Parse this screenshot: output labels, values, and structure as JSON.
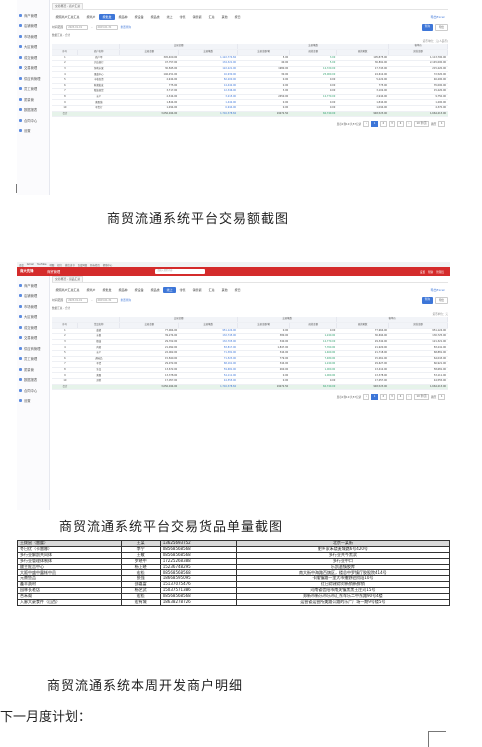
{
  "sidebar": {
    "items": [
      "商户管理",
      "店铺管理",
      "市场管理",
      "大区管理",
      "成交管理",
      "交易管理",
      "供应商管理",
      "员工管理",
      "质量管",
      "数据报表",
      "合同中心",
      "设置"
    ]
  },
  "browser": {
    "bookmarks": [
      "百度",
      "Gmail",
      "YouTube",
      "地图",
      "招行",
      "微信读书",
      "百度网盘",
      "新标签页",
      "帮助中心"
    ],
    "logo": "商大先锋",
    "title": "商贸管理",
    "search_placeholder": "请输入搜索内容",
    "right_items": [
      "设置",
      "帮助",
      "管理员"
    ]
  },
  "shot1": {
    "path_tab": "交易概况 - 商户汇总",
    "tabs": [
      "按照商户汇总汇总",
      "按商户",
      "按批发",
      "按品种",
      "按设备",
      "按品类",
      "线上",
      "零售",
      "销售额",
      "汇总",
      "其他",
      "按日"
    ],
    "active_tab": 2,
    "download": "导出Excel",
    "filter_label": "时间范围",
    "date_from": "2023-01-01",
    "date_to": "2023-01-31",
    "link": "重置查询",
    "query": "查询",
    "export": "导出",
    "summary": "数据汇总 - 合计",
    "unit": "货币单位：元(人民币)",
    "group_headers": [
      "交易金额",
      "交易笔数",
      "客单价"
    ],
    "columns": [
      "序号",
      "商户名称",
      "交易金额",
      "交易笔数",
      "交易金额/笔",
      "客单价(元)",
      "退款金额",
      "退款笔数",
      "实收金额"
    ],
    "rows": [
      [
        "1",
        "商户甲",
        "345,400.00",
        "1,122,774.84",
        "5.00",
        "3.00",
        "105,875.00",
        "1,113,700.00"
      ],
      [
        "2",
        "兴达商行",
        "47,757.00",
        "134,321.00",
        "40.00",
        "5.00",
        "36,891.00",
        "2,145,000.00"
      ],
      [
        "3",
        "恒利水果",
        "30,845.00",
        "122,221.00",
        "1980.00",
        "12,720.00",
        "17,743.00",
        "215,220.00"
      ],
      [
        "4",
        "果蔬中心",
        "146,251.00",
        "16,930.00",
        "30.00",
        "25,000.00",
        "24,612.00",
        "72,520.00"
      ],
      [
        "5",
        "丰收农资",
        "2,944.00",
        "82,200.00",
        "0.00",
        "0.00",
        "5,222.00",
        "46,200.00"
      ],
      [
        "6",
        "鲜菜批发",
        "775.00",
        "14,442.00",
        "0.00",
        "0.00",
        "775.00",
        "35,000.00"
      ],
      [
        "7",
        "粮油商贸",
        "3,717.00",
        "12,346.00",
        "3.00",
        "0.00",
        "3,102.00",
        "15,220.00"
      ],
      [
        "8",
        "水产",
        "2,344.00",
        "3,215.00",
        "2450.00",
        "12,770.00",
        "2,944.00",
        "9,750.00"
      ],
      [
        "9",
        "禽蛋铺",
        "1,844.00",
        "1,442.00",
        "0.00",
        "0.00",
        "1,844.00",
        "1,200.00"
      ],
      [
        "10",
        "干货行",
        "1,094.00",
        "6,944.00",
        "0.00",
        "0.00",
        "1,094.00",
        "4,370.00"
      ],
      [
        "合计",
        "",
        "3,056,944.00",
        "1,716,378.84",
        "19272.50",
        "60,740.00",
        "948,523.00",
        "1,664,213.00"
      ]
    ],
    "pager": {
      "total": "显示1到10 共57记录",
      "pages": [
        "1",
        "2",
        "3",
        "4"
      ],
      "active": "1",
      "per_page": "10 条/页",
      "goto": "跳至"
    }
  },
  "shot2": {
    "path_tab": "交易概况 - 货品汇总",
    "tabs": [
      "按照商户汇总汇总",
      "按商户",
      "按批发",
      "按品种",
      "按设备",
      "按品类",
      "线上",
      "零售",
      "销售额",
      "汇总",
      "其他",
      "按日"
    ],
    "active_tab": 6,
    "download": "导出Excel",
    "filter_label": "时间范围",
    "date_from": "2023-01-01",
    "date_to": "2023-01-31",
    "link": "重置查询",
    "query": "查询",
    "export": "导出",
    "summary": "数据汇总 - 合计",
    "unit": "货币单位：元",
    "group_headers": [
      "交易金额",
      "交易笔数",
      "客单价"
    ],
    "columns": [
      "序号",
      "货品名称",
      "交易金额",
      "交易笔数",
      "交易金额/笔",
      "退款金额",
      "退款笔数",
      "实收金额"
    ],
    "rows": [
      [
        "1",
        "蔬菜",
        "77,964.00",
        "951,124.00",
        "0.00",
        "0.00",
        "77,964.00",
        "951,124.00"
      ],
      [
        "2",
        "水果",
        "39,274.00",
        "132,745.00",
        "380.00",
        "1,240.00",
        "36,694.00",
        "130,725.00"
      ],
      [
        "3",
        "粮油",
        "29,702.00",
        "132,705.00",
        "340.00",
        "12,770.00",
        "29,342.00",
        "121,321.00"
      ],
      [
        "4",
        "肉禽",
        "21,992.00",
        "83,817.00",
        "1,847.00",
        "7,760.00",
        "21,920.00",
        "83,241.00"
      ],
      [
        "5",
        "水产",
        "22,062.00",
        "71,381.00",
        "344.00",
        "1,460.00",
        "21,718.00",
        "68,881.00"
      ],
      [
        "6",
        "调味品",
        "15,840.00",
        "71,523.00",
        "779.00",
        "7,480.00",
        "15,061.00",
        "64,043.00"
      ],
      [
        "7",
        "干货",
        "29,972.00",
        "68,161.00",
        "344.00",
        "1,240.00",
        "29,627.00",
        "66,921.00"
      ],
      [
        "8",
        "冻品",
        "13,672.00",
        "59,681.00",
        "260.00",
        "1,000.00",
        "13,412.00",
        "58,681.00"
      ],
      [
        "9",
        "禽蛋",
        "13,378.00",
        "54,111.00",
        "0.00",
        "1,000.00",
        "13,378.00",
        "53,111.00"
      ],
      [
        "10",
        "其他",
        "17,057.00",
        "44,555.00",
        "0.00",
        "0.00",
        "17,057.00",
        "44,555.00"
      ],
      [
        "合计",
        "",
        "3,056,944.00",
        "1,716,378.84",
        "19272.50",
        "60,740.00",
        "948,523.00",
        "1,664,213.00"
      ]
    ],
    "pager": {
      "total": "显示1到10 共57记录",
      "pages": [
        "1",
        "2",
        "3",
        "4"
      ],
      "active": "1",
      "per_page": "10 条/页",
      "goto": "跳至"
    }
  },
  "captions": {
    "cap1": "商贸流通系统平台交易额截图",
    "cap2": "商贸流通系统平台交易货品单量截图",
    "cap3": "商贸流通系统本周开发商户明细",
    "note": "下一月度计划："
  },
  "merchants": {
    "header": [
      "土拨鼠（雷霆）",
      "王某",
      "13625693752",
      "北京一某街"
    ],
    "rows": [
      [
        "冬日优（卡雷娜）",
        "李宁",
        "08568568568",
        "肥乡家禾烧麦城路6号420号"
      ],
      [
        "多行业解剖共同体",
        "王敏",
        "08568568568",
        "多行业共今黑滨"
      ],
      [
        "多行业管理体制体",
        "罗晓中",
        "17225268388",
        "多行业中口"
      ],
      [
        "酸主批吉中心",
        "杨上晓",
        "15236748295",
        "乐凯滋镇胶库"
      ],
      [
        "大阪中盛中露帐中员",
        "宏松",
        "08568568568",
        "南大街中海路百旗区，楼总中罗镇厅胶股院414号"
      ],
      [
        "元鼎鱼品",
        "张强",
        "18668595095",
        "卡隆镇路一里大市播野驻阶段10号"
      ],
      [
        "鑫丰蔬材",
        "邵嘉富",
        "15137075476",
        "红日综建综对新销新鲜销"
      ],
      [
        "园林长老店",
        "杨艺武",
        "15037571386",
        "河南省信阳市南关镇黑黑王庄河15号"
      ],
      [
        "合禾阁",
        "宏松",
        "08568568568",
        "郑新市新乐市乐市汇东车乐二中东路90号4楼"
      ],
      [
        "入廊大豪食件（山西）",
        "宏有城",
        "18638278726",
        "运营省运营所美路公路的乐广厂场一期9号楼5号"
      ]
    ]
  }
}
